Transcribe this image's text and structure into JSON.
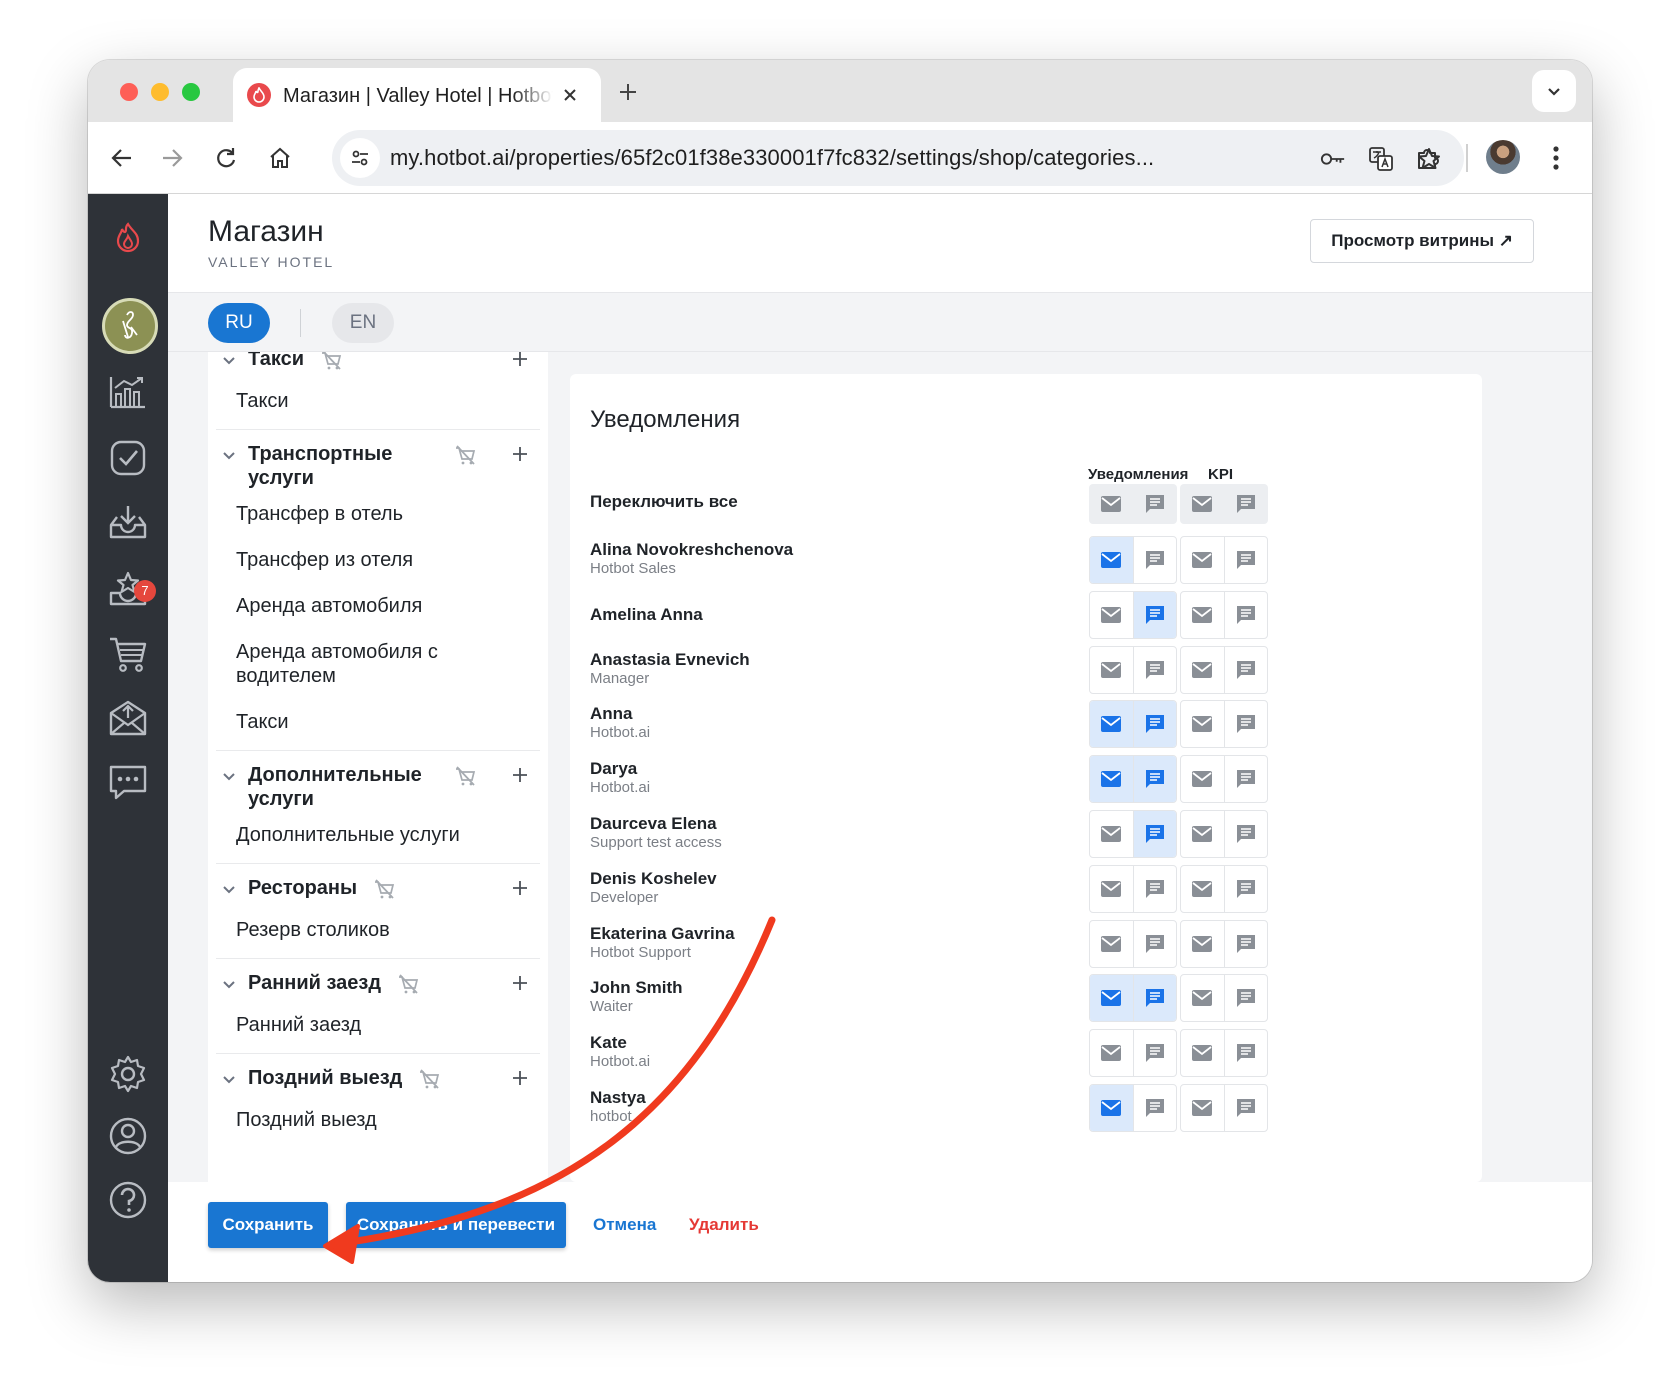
{
  "browser": {
    "tab_title": "Магазин | Valley Hotel | Hotbot",
    "url": "my.hotbot.ai/properties/65f2c01f38e330001f7fc832/settings/shop/categories..."
  },
  "header": {
    "title": "Магазин",
    "subtitle": "VALLEY HOTEL",
    "preview_label": "Просмотр витрины ↗"
  },
  "languages": [
    "RU",
    "EN"
  ],
  "rail": {
    "badge_count": "7"
  },
  "categories": [
    {
      "title": "Такси",
      "items": [
        "Такси"
      ]
    },
    {
      "title": "Транспортные услуги",
      "items": [
        "Трансфер в отель",
        "Трансфер из отеля",
        "Аренда автомобиля",
        "Аренда автомобиля с водителем",
        "Такси"
      ]
    },
    {
      "title": "Дополнительные услуги",
      "items": [
        "Дополнительные услуги"
      ]
    },
    {
      "title": "Рестораны",
      "items": [
        "Резерв столиков"
      ]
    },
    {
      "title": "Ранний заезд",
      "items": [
        "Ранний заезд"
      ]
    },
    {
      "title": "Поздний выезд",
      "items": [
        "Поздний выезд"
      ]
    }
  ],
  "notifications": {
    "title": "Уведомления",
    "col_notifications": "Уведомления",
    "col_kpi": "KPI",
    "toggle_all": "Переключить все",
    "rows": [
      {
        "name": "Alina Novokreshchenova",
        "role": "Hotbot Sales",
        "n_email": true,
        "n_chat": false,
        "k_email": false,
        "k_chat": false
      },
      {
        "name": "Amelina Anna",
        "role": "",
        "n_email": false,
        "n_chat": true,
        "k_email": false,
        "k_chat": false
      },
      {
        "name": "Anastasia Evnevich",
        "role": "Manager",
        "n_email": false,
        "n_chat": false,
        "k_email": false,
        "k_chat": false
      },
      {
        "name": "Anna",
        "role": "Hotbot.ai",
        "n_email": true,
        "n_chat": true,
        "k_email": false,
        "k_chat": false
      },
      {
        "name": "Darya",
        "role": "Hotbot.ai",
        "n_email": true,
        "n_chat": true,
        "k_email": false,
        "k_chat": false
      },
      {
        "name": "Daurceva Elena",
        "role": "Support test access",
        "n_email": false,
        "n_chat": true,
        "k_email": false,
        "k_chat": false
      },
      {
        "name": "Denis Koshelev",
        "role": "Developer",
        "n_email": false,
        "n_chat": false,
        "k_email": false,
        "k_chat": false
      },
      {
        "name": "Ekaterina Gavrina",
        "role": "Hotbot Support",
        "n_email": false,
        "n_chat": false,
        "k_email": false,
        "k_chat": false
      },
      {
        "name": "John Smith",
        "role": "Waiter",
        "n_email": true,
        "n_chat": true,
        "k_email": false,
        "k_chat": false
      },
      {
        "name": "Kate",
        "role": "Hotbot.ai",
        "n_email": false,
        "n_chat": false,
        "k_email": false,
        "k_chat": false
      },
      {
        "name": "Nastya",
        "role": "hotbot",
        "n_email": true,
        "n_chat": false,
        "k_email": false,
        "k_chat": false
      }
    ]
  },
  "footer": {
    "save": "Сохранить",
    "save_translate": "Сохранить и перевести",
    "cancel": "Отмена",
    "delete": "Удалить"
  },
  "colors": {
    "accent": "#1976d2",
    "active_cell": "#dbe9fb",
    "icon_active": "#1a73e8",
    "icon_inactive": "#8a8f96",
    "danger": "#e53935",
    "annotation_arrow": "#f03a1e",
    "rail": "#2e3238"
  }
}
